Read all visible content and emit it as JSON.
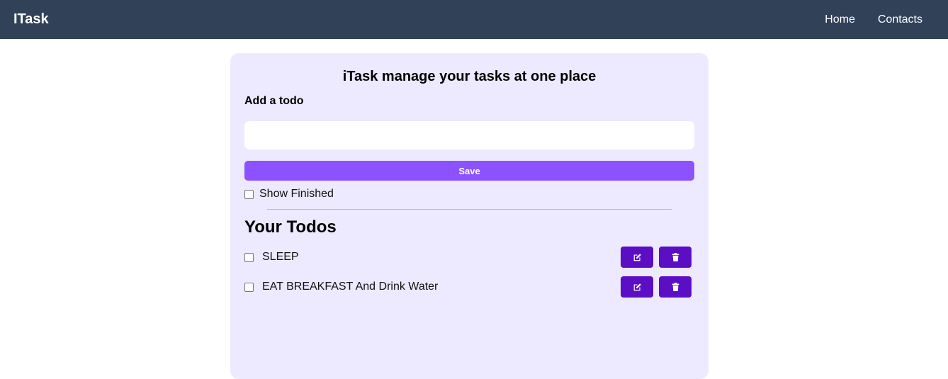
{
  "navbar": {
    "brand": "ITask",
    "links": [
      "Home",
      "Contacts"
    ]
  },
  "main": {
    "title": "iTask manage your tasks at one place",
    "add_label": "Add a todo",
    "input": {
      "value": "",
      "placeholder": ""
    },
    "save_label": "Save",
    "show_finished_label": "Show Finished",
    "show_finished_checked": false,
    "todos_heading": "Your Todos",
    "todos": [
      {
        "text": "SLEEP",
        "completed": false
      },
      {
        "text": "EAT BREAKFAST And Drink Water",
        "completed": false
      }
    ]
  },
  "colors": {
    "navbar_bg": "#314158",
    "panel_bg": "#ede9fe",
    "save_button": "#8c52ff",
    "action_button": "#5b0ec4"
  },
  "icons": {
    "edit": "edit-icon",
    "delete": "trash-icon"
  }
}
